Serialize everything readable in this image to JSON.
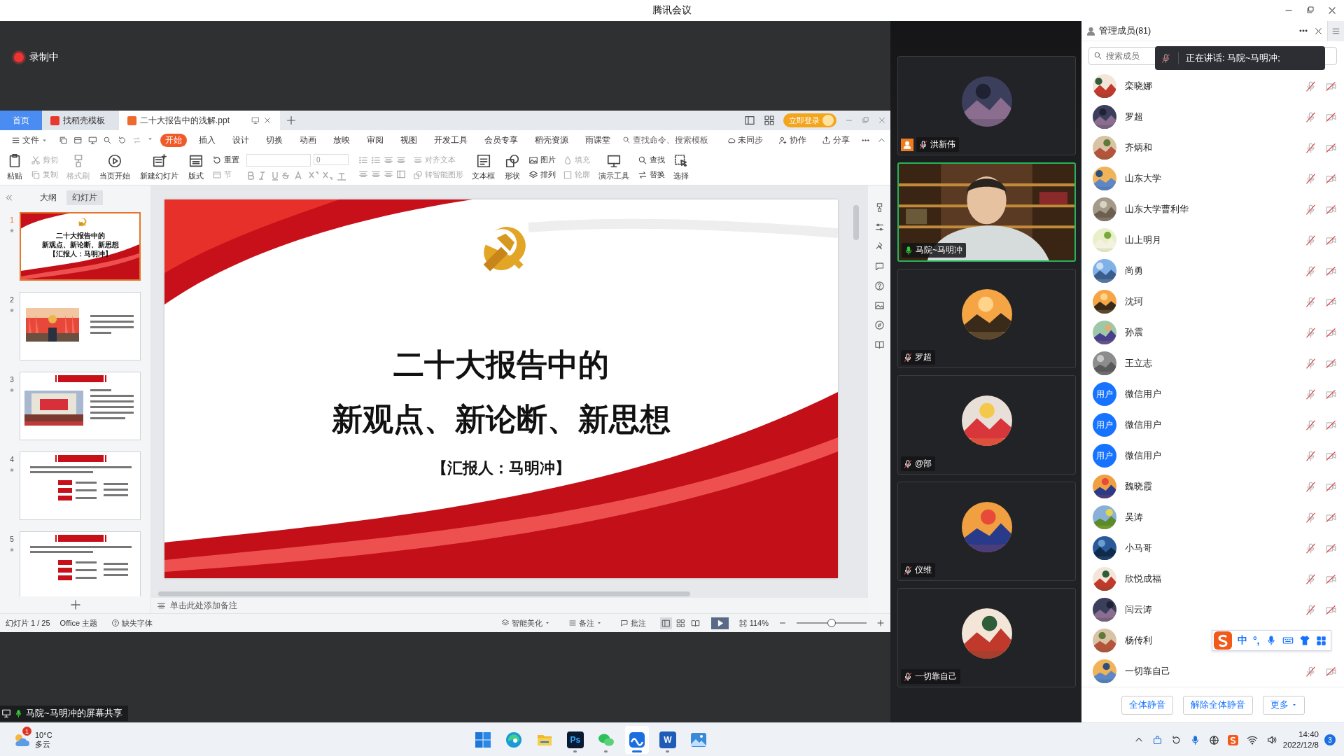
{
  "window": {
    "title": "腾讯会议"
  },
  "recording": {
    "label": "录制中"
  },
  "wps": {
    "tabs": [
      {
        "label": "首页",
        "kind": "home",
        "selected": false
      },
      {
        "label": "找稻壳模板",
        "kind": "docer",
        "selected": false
      },
      {
        "label": "二十大报告中的浅解.ppt",
        "kind": "doc",
        "selected": true
      }
    ],
    "login": "立即登录",
    "file_menu": "文件",
    "menu": [
      {
        "label": "开始",
        "selected": true
      },
      {
        "label": "插入",
        "selected": false
      },
      {
        "label": "设计",
        "selected": false
      },
      {
        "label": "切换",
        "selected": false
      },
      {
        "label": "动画",
        "selected": false
      },
      {
        "label": "放映",
        "selected": false
      },
      {
        "label": "审阅",
        "selected": false
      },
      {
        "label": "视图",
        "selected": false
      },
      {
        "label": "开发工具",
        "selected": false
      },
      {
        "label": "会员专享",
        "selected": false
      },
      {
        "label": "稻壳资源",
        "selected": false
      },
      {
        "label": "雨课堂",
        "selected": false
      }
    ],
    "search": {
      "placeholder": "查找命令、搜索模板"
    },
    "actions": [
      "未同步",
      "协作",
      "分享"
    ],
    "ribbon": [
      {
        "kind": "big",
        "label": "粘贴",
        "disabled": false
      },
      {
        "kind": "stack",
        "items": [
          {
            "label": "剪切",
            "disabled": true
          },
          {
            "label": "复制",
            "disabled": true
          }
        ]
      },
      {
        "kind": "big",
        "label": "格式刷",
        "disabled": true
      },
      {
        "kind": "big",
        "label": "当页开始",
        "disabled": false
      },
      {
        "kind": "big",
        "label": "新建幻灯片",
        "disabled": false
      },
      {
        "kind": "big",
        "label": "版式",
        "disabled": false
      },
      {
        "kind": "stack",
        "items": [
          {
            "label": "重置",
            "disabled": false
          },
          {
            "label": "节",
            "disabled": true
          }
        ]
      },
      {
        "kind": "font",
        "size": "0"
      },
      {
        "kind": "paragraph"
      },
      {
        "kind": "stack",
        "items": [
          {
            "label": "对齐文本",
            "disabled": true
          },
          {
            "label": "转智能图形",
            "disabled": true
          }
        ]
      },
      {
        "kind": "big",
        "label": "文本框",
        "disabled": false
      },
      {
        "kind": "big",
        "label": "形状",
        "disabled": false
      },
      {
        "kind": "stack",
        "items": [
          {
            "label": "图片",
            "disabled": false
          },
          {
            "label": "排列",
            "disabled": false
          }
        ]
      },
      {
        "kind": "stack",
        "items": [
          {
            "label": "填充",
            "disabled": true
          },
          {
            "label": "轮廓",
            "disabled": true
          }
        ]
      },
      {
        "kind": "big",
        "label": "演示工具",
        "disabled": false
      },
      {
        "kind": "stack",
        "items": [
          {
            "label": "查找",
            "disabled": false
          },
          {
            "label": "替换",
            "disabled": false
          }
        ]
      },
      {
        "kind": "big",
        "label": "选择",
        "disabled": false
      }
    ],
    "panel_tabs": [
      {
        "label": "大纲",
        "selected": false
      },
      {
        "label": "幻灯片",
        "selected": true
      }
    ],
    "thumbnails": [
      {
        "number": "1",
        "kind": "title",
        "selected": true,
        "lines": [
          "二十大报告中的",
          "新观点、新论断、新思想",
          "【汇报人：马明冲】"
        ]
      },
      {
        "number": "2",
        "selected": false
      },
      {
        "number": "3",
        "kind": "banner_photo",
        "selected": false
      },
      {
        "number": "4",
        "kind": "banner_list",
        "selected": false
      },
      {
        "number": "5",
        "kind": "banner_list",
        "selected": false
      }
    ],
    "slide": {
      "title_lines": [
        "二十大报告中的",
        "新观点、新论断、新思想"
      ],
      "presenter": "【汇报人：马明冲】"
    },
    "notes": {
      "placeholder": "单击此处添加备注"
    },
    "status": {
      "slide": "幻灯片 1 / 25",
      "theme": "Office 主题",
      "missing_font": "缺失字体",
      "beautify": "智能美化",
      "notes": "备注",
      "comments": "批注",
      "zoom": "114%",
      "zoom_slider": {
        "level": 0.5
      },
      "views": [
        {
          "kind": "normal",
          "selected": true
        },
        {
          "kind": "sorter",
          "selected": false
        },
        {
          "kind": "reading",
          "selected": false
        }
      ]
    }
  },
  "share_label": "马院~马明冲的屏幕共享",
  "video_tiles": [
    {
      "name": "洪新伟",
      "kind": "avatar",
      "muted": true,
      "speaking": false,
      "host": true
    },
    {
      "name": "马院~马明冲",
      "kind": "video",
      "muted": false,
      "speaking": true,
      "host": false
    },
    {
      "name": "罗超",
      "kind": "avatar",
      "muted": true,
      "speaking": false,
      "host": false
    },
    {
      "name": "@部",
      "kind": "avatar",
      "muted": true,
      "speaking": false,
      "host": false
    },
    {
      "name": "仪维",
      "kind": "avatar",
      "muted": true,
      "speaking": false,
      "host": false
    },
    {
      "name": "一切靠自己",
      "kind": "avatar",
      "muted": true,
      "speaking": false,
      "host": false
    }
  ],
  "members": {
    "title": "管理成员(81)",
    "search": {
      "placeholder": "搜索成员"
    },
    "speaking_toast": "正在讲话: 马院~马明冲;",
    "list": [
      {
        "name": "栾晓娜",
        "muted": true,
        "video_off": true
      },
      {
        "name": "罗超",
        "muted": true,
        "video_off": true
      },
      {
        "name": "齐炳和",
        "muted": true,
        "video_off": true
      },
      {
        "name": "山东大学",
        "muted": true,
        "video_off": true
      },
      {
        "name": "山东大学曹利华",
        "muted": true,
        "video_off": true
      },
      {
        "name": "山上明月",
        "muted": true,
        "video_off": true
      },
      {
        "name": "尚勇",
        "muted": true,
        "video_off": true
      },
      {
        "name": "沈珂",
        "muted": true,
        "video_off": true
      },
      {
        "name": "孙震",
        "muted": true,
        "video_off": true
      },
      {
        "name": "王立志",
        "muted": true,
        "video_off": true
      },
      {
        "name": "微信用户",
        "avatar_text": "用户",
        "muted": true,
        "video_off": true
      },
      {
        "name": "微信用户",
        "avatar_text": "用户",
        "muted": true,
        "video_off": true
      },
      {
        "name": "微信用户",
        "avatar_text": "用户",
        "muted": true,
        "video_off": true
      },
      {
        "name": "魏晓霞",
        "muted": true,
        "video_off": true
      },
      {
        "name": "吴涛",
        "muted": true,
        "video_off": true
      },
      {
        "name": "小马哥",
        "muted": true,
        "video_off": true
      },
      {
        "name": "欣悦成福",
        "muted": true,
        "video_off": true
      },
      {
        "name": "闫云涛",
        "muted": true,
        "video_off": true
      },
      {
        "name": "杨传利"
      },
      {
        "name": "一切靠自己",
        "muted": true,
        "video_off": true
      }
    ],
    "buttons": [
      "全体静音",
      "解除全体静音",
      "更多"
    ],
    "ime": {
      "mode": "中",
      "punctuation": "°,"
    }
  },
  "taskbar": {
    "weather": {
      "temp": "10°C",
      "condition": "多云",
      "badge": "1"
    },
    "apps": [
      {
        "kind": "start",
        "running": false,
        "selected": false
      },
      {
        "kind": "edge",
        "running": false,
        "selected": false
      },
      {
        "kind": "files",
        "running": false,
        "selected": false
      },
      {
        "kind": "ps",
        "label": "Ps",
        "running": true,
        "selected": false
      },
      {
        "kind": "wechat",
        "running": true,
        "selected": false
      },
      {
        "kind": "meeting",
        "running": true,
        "selected": true
      },
      {
        "kind": "word",
        "label": "W",
        "running": true,
        "selected": false
      },
      {
        "kind": "photos",
        "running": false,
        "selected": false
      }
    ],
    "time": "14:40",
    "date": "2022/12/8",
    "notifications": "3"
  }
}
